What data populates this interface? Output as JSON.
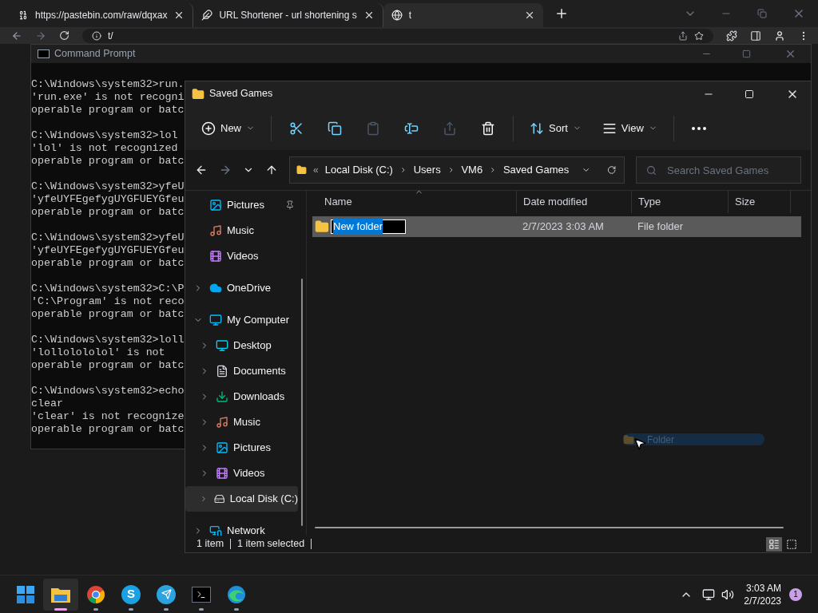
{
  "browser": {
    "tabs": [
      {
        "title": "https://pastebin.com/raw/dqxax",
        "kind": "binary",
        "selected": false
      },
      {
        "title": "URL Shortener - url shortening s",
        "kind": "feather",
        "selected": false
      },
      {
        "title": "t",
        "kind": "globe",
        "selected": true
      }
    ],
    "address": "t/"
  },
  "cmd": {
    "title": "Command Prompt",
    "blocks": [
      [
        "C:\\Windows\\system32>run.",
        "'run.exe' is not recogni",
        "operable program or batc"
      ],
      [
        "C:\\Windows\\system32>lol",
        "'lol' is not recognized",
        "operable program or batc"
      ],
      [
        "C:\\Windows\\system32>yfeU",
        "'yfeUYFEgefygUYGFUEYGfeu",
        "operable program or batc"
      ],
      [
        "C:\\Windows\\system32>yfeU",
        "'yfeUYFEgefygUYGFUEYGfeu",
        "operable program or batc"
      ],
      [
        "C:\\Windows\\system32>C:\\P",
        "'C:\\Program' is not reco",
        "operable program or batc"
      ],
      [
        "C:\\Windows\\system32>loll",
        "'lollolololol' is not",
        "operable program or batc"
      ],
      [
        "C:\\Windows\\system32>echo",
        "clear",
        "'clear' is not recognize",
        "operable program or batc"
      ]
    ]
  },
  "explorer": {
    "title": "Saved Games",
    "toolbar": [
      [
        {
          "kind": "new",
          "label": "New",
          "disabled": false
        }
      ],
      [
        {
          "kind": "cut",
          "disabled": false
        },
        {
          "kind": "copy",
          "disabled": false
        },
        {
          "kind": "paste",
          "disabled": true
        },
        {
          "kind": "rename",
          "disabled": false
        },
        {
          "kind": "share",
          "disabled": true
        },
        {
          "kind": "delete",
          "disabled": false
        }
      ],
      [
        {
          "kind": "sort",
          "label": "Sort",
          "disabled": false
        },
        {
          "kind": "view",
          "label": "View",
          "disabled": false
        }
      ],
      [
        {
          "kind": "more",
          "disabled": false
        }
      ]
    ],
    "overflow": "«",
    "breadcrumb": [
      "Local Disk (C:)",
      "Users",
      "VM6",
      "Saved Games"
    ],
    "search": {
      "placeholder": "Search Saved Games"
    },
    "quick": [
      {
        "label": "Pictures",
        "kind": "pictures",
        "pinned": true
      },
      {
        "label": "Music",
        "kind": "music",
        "pinned": false
      },
      {
        "label": "Videos",
        "kind": "videos",
        "pinned": false
      }
    ],
    "tree": [
      {
        "label": "OneDrive",
        "kind": "cloud",
        "expanded": false,
        "selected": false
      },
      {
        "label": "My Computer",
        "kind": "computer",
        "expanded": true,
        "selected": false,
        "children": [
          {
            "label": "Desktop",
            "kind": "desktop",
            "expanded": false,
            "selected": false
          },
          {
            "label": "Documents",
            "kind": "documents",
            "expanded": false,
            "selected": false
          },
          {
            "label": "Downloads",
            "kind": "downloads",
            "expanded": false,
            "selected": false
          },
          {
            "label": "Music",
            "kind": "music",
            "expanded": false,
            "selected": false
          },
          {
            "label": "Pictures",
            "kind": "pictures",
            "expanded": false,
            "selected": false
          },
          {
            "label": "Videos",
            "kind": "videos",
            "expanded": false,
            "selected": false
          },
          {
            "label": "Local Disk (C:)",
            "kind": "disk",
            "expanded": false,
            "selected": true
          }
        ]
      },
      {
        "label": "Network",
        "kind": "network",
        "expanded": false,
        "selected": false
      }
    ],
    "columns": [
      {
        "label": "Name",
        "sorted": true
      },
      {
        "label": "Date modified",
        "sorted": false
      },
      {
        "label": "Type",
        "sorted": false
      },
      {
        "label": "Size",
        "sorted": false
      }
    ],
    "rows": [
      {
        "name": "New folder",
        "date": "2/7/2023 3:03 AM",
        "type": "File folder",
        "selected": true,
        "editing": true
      }
    ],
    "status": [
      "1 item",
      "1 item selected"
    ],
    "views": [
      {
        "kind": "details",
        "selected": true
      },
      {
        "kind": "tiles",
        "selected": false
      }
    ],
    "drag": {
      "label": "Folder"
    }
  },
  "taskbar": {
    "apps": [
      {
        "kind": "start",
        "running": false,
        "active": false
      },
      {
        "kind": "explorer",
        "running": true,
        "active": true
      },
      {
        "kind": "chrome",
        "running": true,
        "active": false
      },
      {
        "kind": "skype",
        "glyph": "S",
        "running": true,
        "active": false
      },
      {
        "kind": "telegram",
        "running": true,
        "active": false
      },
      {
        "kind": "terminal",
        "running": true,
        "active": false
      },
      {
        "kind": "edge",
        "running": true,
        "active": false
      }
    ],
    "time": "3:03 AM",
    "date": "2/7/2023",
    "notifications": "1"
  }
}
